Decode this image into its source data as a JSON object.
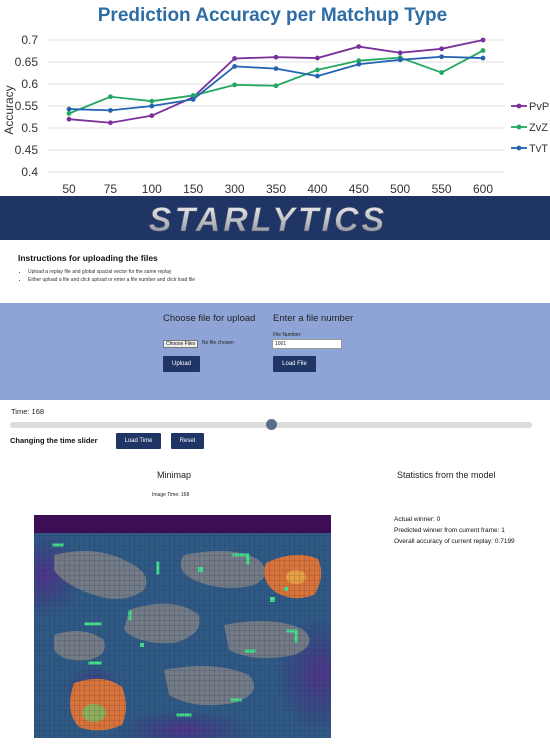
{
  "chart_data": {
    "type": "line",
    "title": "Prediction Accuracy per Matchup Type",
    "xlabel": "",
    "ylabel": "Accuracy",
    "categories": [
      "50",
      "75",
      "100",
      "150",
      "300",
      "350",
      "400",
      "450",
      "500",
      "550",
      "600"
    ],
    "ylim": [
      0.4,
      0.7
    ],
    "yticks": [
      "0.4",
      "0.45",
      "0.5",
      "0.55",
      "0.6",
      "0.65",
      "0.7"
    ],
    "grid": true,
    "legend": "right",
    "series": [
      {
        "name": "PvP",
        "color": "#7a2f9a",
        "values": [
          0.52,
          0.512,
          0.528,
          0.57,
          0.658,
          0.661,
          0.659,
          0.685,
          0.671,
          0.68,
          0.7
        ]
      },
      {
        "name": "ZvZ",
        "color": "#22a860",
        "values": [
          0.533,
          0.571,
          0.561,
          0.574,
          0.598,
          0.596,
          0.632,
          0.653,
          0.66,
          0.626,
          0.676
        ]
      },
      {
        "name": "TvT",
        "color": "#2463b0",
        "values": [
          0.543,
          0.54,
          0.55,
          0.565,
          0.64,
          0.635,
          0.618,
          0.645,
          0.655,
          0.662,
          0.659
        ]
      }
    ]
  },
  "banner": {
    "logo_text": "STARLYTICS"
  },
  "instructions": {
    "title": "Instructions for uploading the files",
    "items": [
      "Upload a replay file and global spacial vector for the same replay",
      "Either upload a file and click upload or enter a file number and click load file"
    ]
  },
  "upload": {
    "choose_title": "Choose file for upload",
    "choose_button": "Choose Files",
    "no_file": "No file chosen",
    "upload_button": "Upload"
  },
  "file_number": {
    "title": "Enter a file number",
    "label": "File Number:",
    "value": "1001",
    "load_button": "Load File"
  },
  "time": {
    "label": "Time: 168",
    "slider_fraction": 0.5
  },
  "time_controls": {
    "label": "Changing the time slider",
    "load_button": "Load Time",
    "reset_button": "Reset"
  },
  "minimap": {
    "title": "Minimap",
    "image_time": "Image Time: 168"
  },
  "stats": {
    "title": "Statistics from the model",
    "actual_winner": "Actual winner: 0",
    "predicted_winner": "Predicted winner from current frame: 1",
    "overall_accuracy": "Overall accuracy of current replay: 0.7199"
  }
}
